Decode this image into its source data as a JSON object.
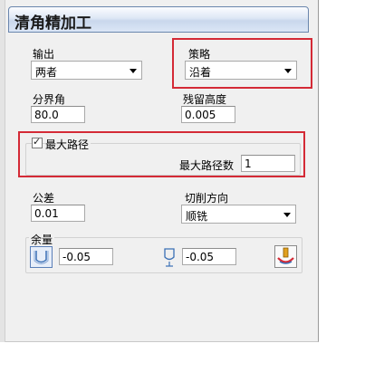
{
  "dialog": {
    "title": "清角精加工"
  },
  "output": {
    "label": "输出",
    "value": "两者"
  },
  "strategy": {
    "label": "策略",
    "value": "沿着"
  },
  "threshold_angle": {
    "label": "分界角",
    "value": "80.0"
  },
  "cusp_height": {
    "label": "残留高度",
    "value": "0.005"
  },
  "max_paths": {
    "checkbox_label": "最大路径",
    "checked": true,
    "count_label": "最大路径数",
    "count_value": "1"
  },
  "tolerance": {
    "label": "公差",
    "value": "0.01"
  },
  "cut_direction": {
    "label": "切削方向",
    "value": "顺铣"
  },
  "allowance": {
    "label": "余量",
    "radial_icon": "radial-thickness-icon",
    "radial_value": "-0.05",
    "axial_icon": "axial-thickness-icon",
    "axial_value": "-0.05",
    "settings_icon": "thickness-settings-icon"
  },
  "colors": {
    "highlight": "#d42a36",
    "title_border": "#6a86ad"
  }
}
